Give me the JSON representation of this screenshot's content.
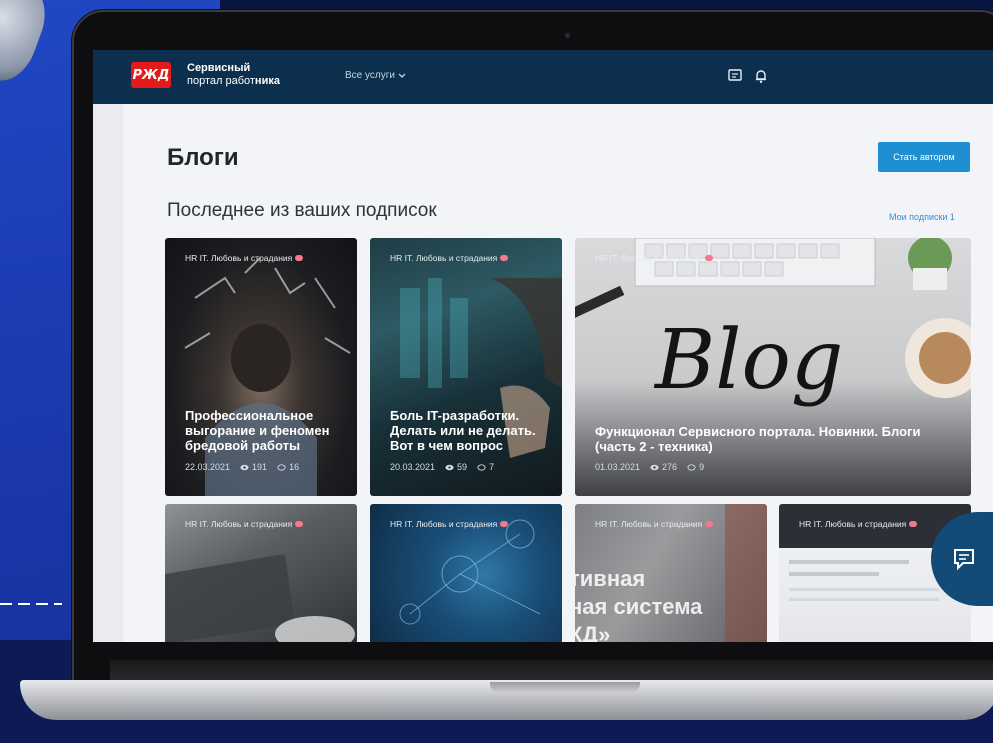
{
  "header": {
    "logo_mark": "РЖД",
    "logo_line1": "Сервисный",
    "logo_line2_a": "портал работ",
    "logo_line2_b": "ника",
    "services_label": "Все услуги",
    "accent_color": "#e21a1a",
    "header_bg": "#0b2f4d",
    "icons": [
      "chat-icon",
      "bell-icon"
    ]
  },
  "page": {
    "title": "Блоги",
    "become_author_label": "Стать автором",
    "section_title": "Последнее из ваших подписок",
    "subscriptions_link": "Мои подписки 1",
    "button_color": "#1e8fd1"
  },
  "cards": [
    {
      "tag": "HR IT. Любовь и страдания",
      "title": "Профессиональное выгорание и феномен бредовой работы",
      "date": "22.03.2021",
      "views": "191",
      "comments": "16"
    },
    {
      "tag": "HR IT. Любовь и страдания",
      "title": "Боль IT-разработки. Делать или не делать. Вот в чем вопрос",
      "date": "20.03.2021",
      "views": "59",
      "comments": "7"
    },
    {
      "tag": "HR IT. Любовь и страдания",
      "title": "Функционал Сервисного портала. Новинки. Блоги (часть 2 - техника)",
      "date": "01.03.2021",
      "views": "276",
      "comments": "9",
      "image_text": "Blog"
    },
    {
      "tag": "HR IT. Любовь и страдания"
    },
    {
      "tag": "HR IT. Любовь и страдания"
    },
    {
      "tag": "HR IT. Любовь и страдания",
      "image_text_1": "тивная",
      "image_text_2": "ная система",
      "image_text_3": "КД»"
    },
    {
      "tag": "HR IT. Любовь и страдания"
    }
  ]
}
